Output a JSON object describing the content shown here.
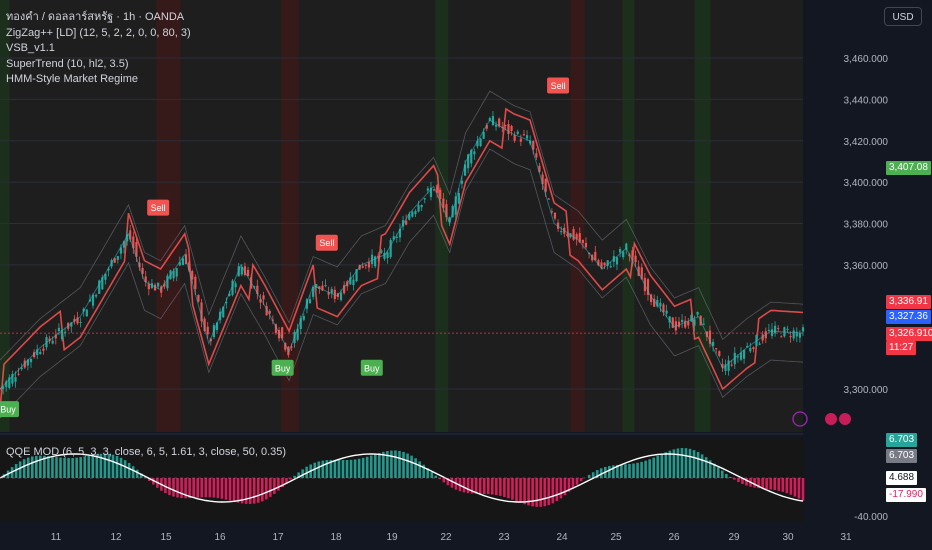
{
  "legend": {
    "symbol": "ทองคำ / ดอลลาร์สหรัฐ · 1h · OANDA",
    "ind1": "ZigZag++ [LD] (12, 5, 2, 2, 0, 0, 80, 3)",
    "ind2": "VSB_v1.1",
    "ind3": "SuperTrend (10, hl2, 3.5)",
    "ind4": "HMM-Style Market Regime"
  },
  "qqe_legend": "QQE MOD (6, 5, 3, 3, close, 6, 5, 1.61, 3, close, 50, 0.35)",
  "currency": "USD",
  "price_tags": {
    "last": "3,407.08",
    "upper": "3,336.91",
    "mid": "3,327.36",
    "current": "3,326.910",
    "countdown": "11:27"
  },
  "qqe_tags": {
    "a": "6.703",
    "b": "6.703",
    "c": "4.688",
    "d": "-17.990"
  },
  "colors": {
    "background": "#131722",
    "bull": "#26a69a",
    "bear": "#ef5350",
    "buy_label": "#4caf50",
    "sell_label": "#f05350",
    "supertrend_up": "#8bc34a",
    "supertrend_down": "#ff5252",
    "blue_tag": "#2962ff",
    "pink": "#e91e63"
  },
  "chart_data": {
    "type": "candlestick",
    "price_axis": {
      "ticks": [
        "3,460.000",
        "3,440.000",
        "3,420.000",
        "3,400.000",
        "3,380.000",
        "3,360.000",
        "3,300.000"
      ],
      "range": [
        3290,
        3470
      ]
    },
    "x_ticks": [
      "11",
      "12",
      "15",
      "16",
      "17",
      "18",
      "19",
      "22",
      "23",
      "24",
      "25",
      "26",
      "29",
      "30",
      "31"
    ],
    "close_path": [
      [
        0,
        3300
      ],
      [
        0.05,
        3320
      ],
      [
        0.1,
        3335
      ],
      [
        0.13,
        3355
      ],
      [
        0.16,
        3375
      ],
      [
        0.18,
        3352
      ],
      [
        0.2,
        3348
      ],
      [
        0.23,
        3365
      ],
      [
        0.26,
        3322
      ],
      [
        0.3,
        3360
      ],
      [
        0.33,
        3340
      ],
      [
        0.36,
        3318
      ],
      [
        0.39,
        3350
      ],
      [
        0.42,
        3345
      ],
      [
        0.45,
        3360
      ],
      [
        0.48,
        3365
      ],
      [
        0.51,
        3385
      ],
      [
        0.54,
        3398
      ],
      [
        0.56,
        3380
      ],
      [
        0.58,
        3410
      ],
      [
        0.61,
        3430
      ],
      [
        0.64,
        3423
      ],
      [
        0.66,
        3420
      ],
      [
        0.69,
        3380
      ],
      [
        0.72,
        3372
      ],
      [
        0.75,
        3358
      ],
      [
        0.78,
        3368
      ],
      [
        0.81,
        3345
      ],
      [
        0.84,
        3330
      ],
      [
        0.87,
        3335
      ],
      [
        0.9,
        3310
      ],
      [
        0.93,
        3320
      ],
      [
        0.96,
        3328
      ],
      [
        1.0,
        3327
      ]
    ],
    "signals": [
      {
        "label": "Buy",
        "type": "buy",
        "t": 0.01,
        "price": 3298
      },
      {
        "label": "Sell",
        "type": "sell",
        "t": 0.197,
        "price": 3379
      },
      {
        "label": "Buy",
        "type": "buy",
        "t": 0.352,
        "price": 3318
      },
      {
        "label": "Sell",
        "type": "sell",
        "t": 0.407,
        "price": 3362
      },
      {
        "label": "Buy",
        "type": "buy",
        "t": 0.463,
        "price": 3318
      },
      {
        "label": "Sell",
        "type": "sell",
        "t": 0.695,
        "price": 3438
      }
    ],
    "qqe_axis": {
      "ticks": [
        "-40.000"
      ]
    }
  }
}
